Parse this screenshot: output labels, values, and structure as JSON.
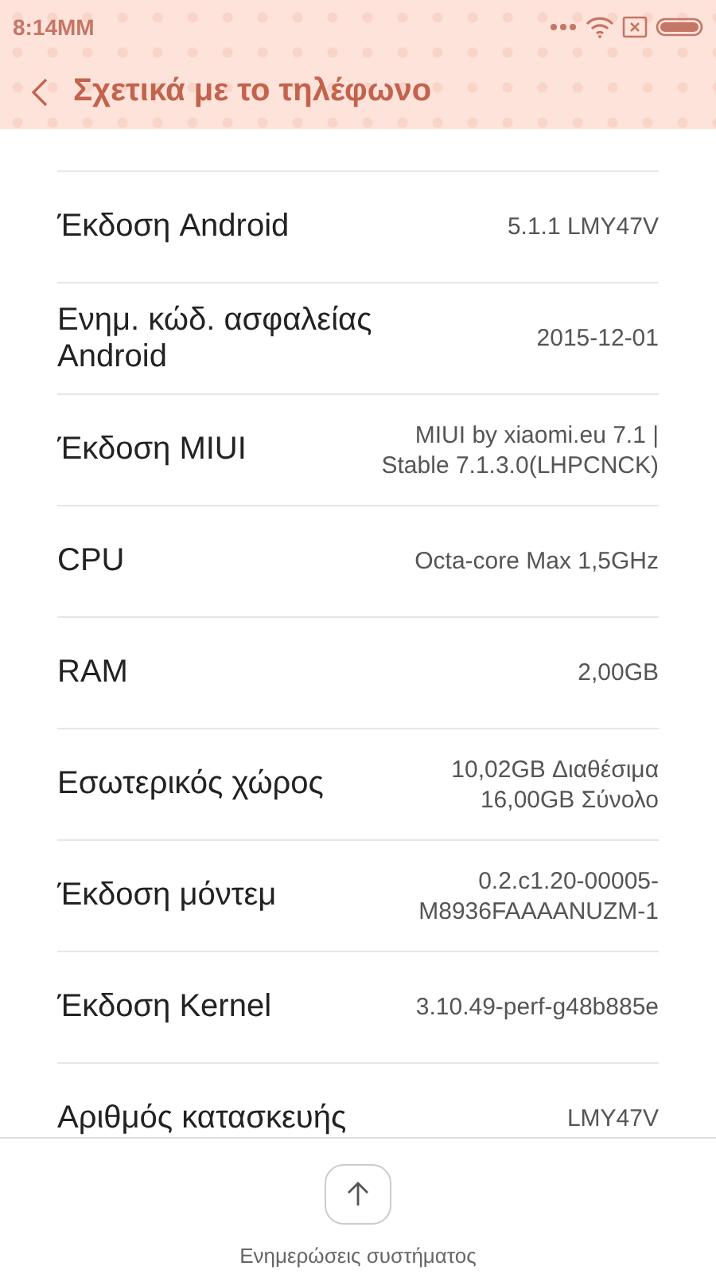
{
  "status_bar": {
    "time": "8:14MM"
  },
  "header": {
    "title": "Σχετικά με το τηλέφωνο"
  },
  "rows": [
    {
      "label": "Έκδοση Android",
      "value": "5.1.1 LMY47V"
    },
    {
      "label": "Ενημ. κώδ. ασφαλείας Android",
      "value": "2015-12-01"
    },
    {
      "label": "Έκδοση MIUI",
      "value": "MIUI by xiaomi.eu 7.1 | Stable 7.1.3.0(LHPCNCK)"
    },
    {
      "label": "CPU",
      "value": "Octa-core Max 1,5GHz"
    },
    {
      "label": "RAM",
      "value": "2,00GB"
    },
    {
      "label": "Εσωτερικός χώρος",
      "value": "10,02GB Διαθέσιμα 16,00GB Σύνολο"
    },
    {
      "label": "Έκδοση μόντεμ",
      "value": "0.2.c1.20-00005-M8936FAAAANUZM-1"
    },
    {
      "label": "Έκδοση Kernel",
      "value": "3.10.49-perf-g48b885e"
    },
    {
      "label": "Αριθμός κατασκευής",
      "value": "LMY47V"
    }
  ],
  "bottom_bar": {
    "label": "Ενημερώσεις συστήματος"
  }
}
